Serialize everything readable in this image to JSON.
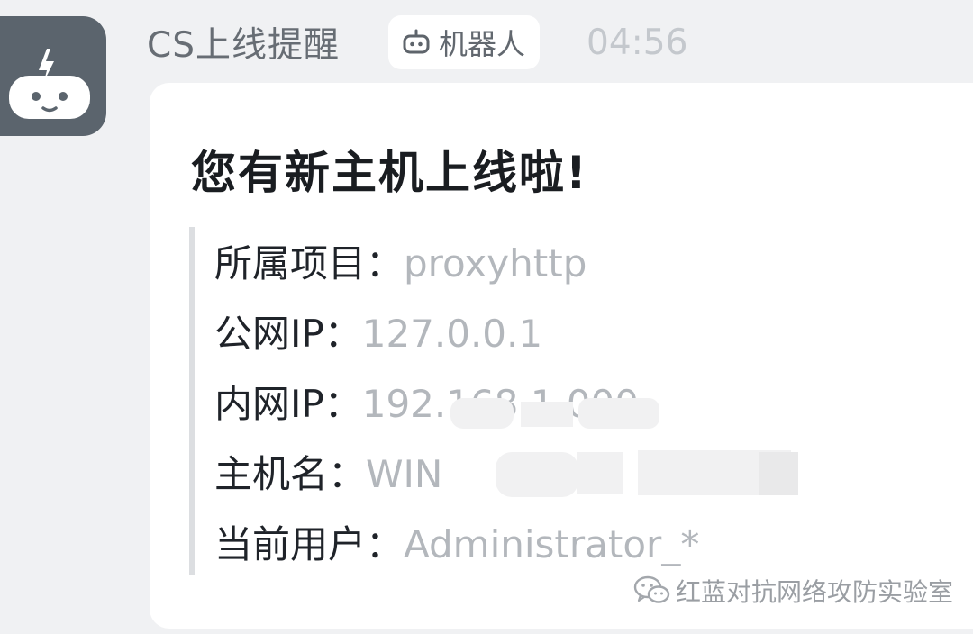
{
  "sender": {
    "name": "CS上线提醒",
    "avatar_icon": "robot-avatar-icon",
    "tag_label": "机器人",
    "tag_icon": "robot-icon",
    "time": "04:56"
  },
  "card": {
    "title": "您有新主机上线啦!",
    "fields": [
      {
        "label": "所属项目：",
        "value": "proxyhttp"
      },
      {
        "label": "公网IP：",
        "value": "127.0.0.1"
      },
      {
        "label": "内网IP：",
        "value": "192.168.1.000",
        "redacted": true
      },
      {
        "label": "主机名：",
        "value": "WIN",
        "redacted": true
      },
      {
        "label": "当前用户：",
        "value": "Administrator_*"
      }
    ]
  },
  "watermark": {
    "icon": "wechat-icon",
    "text": "红蓝对抗网络攻防实验室"
  },
  "colors": {
    "background": "#f0f1f3",
    "avatar": "#5b646d",
    "card": "#ffffff"
  }
}
